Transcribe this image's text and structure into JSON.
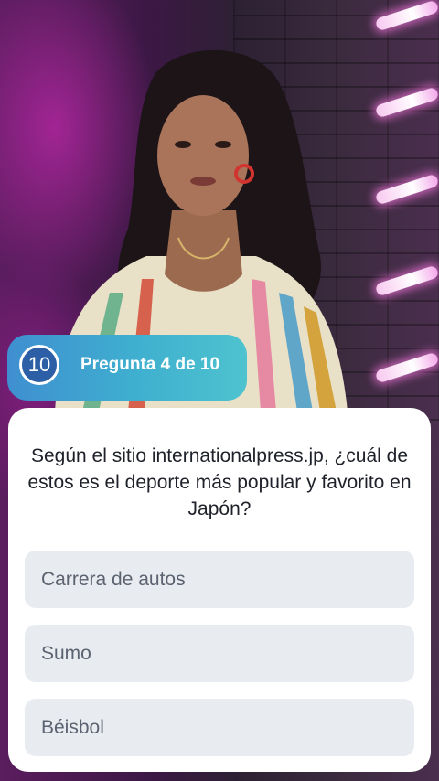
{
  "quiz": {
    "timer_value": "10",
    "progress_label": "Pregunta 4 de 10",
    "question_text": "Según el sitio internationalpress.jp, ¿cuál de estos es el deporte más popular y favorito en Japón?",
    "options": [
      {
        "label": "Carrera de autos"
      },
      {
        "label": "Sumo"
      },
      {
        "label": "Béisbol"
      }
    ]
  },
  "colors": {
    "badge_gradient_start": "#3f8fd0",
    "badge_gradient_end": "#4ec3cf",
    "timer_fill": "#2c5fa5",
    "card_background": "#ffffff",
    "option_background": "#e8ebef",
    "option_text": "#5b6371",
    "question_text": "#1e2129"
  }
}
